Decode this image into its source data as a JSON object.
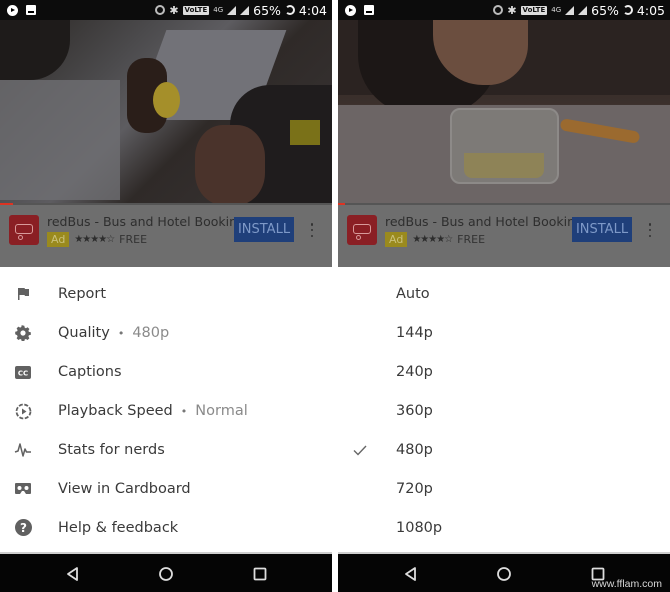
{
  "screens": [
    {
      "status_bar": {
        "battery": "65%",
        "time": "4:04",
        "volte": "VoLTE",
        "network": "4G"
      },
      "video": {
        "progress": 0.04
      },
      "ad": {
        "title": "redBus - Bus and Hotel Booking",
        "badge": "Ad",
        "stars": "★★★★☆",
        "price": "FREE",
        "install_label": "INSTALL"
      },
      "menu": {
        "items": [
          {
            "icon": "flag-icon",
            "label": "Report",
            "value": ""
          },
          {
            "icon": "gear-icon",
            "label": "Quality",
            "value": "480p"
          },
          {
            "icon": "closed-captions-icon",
            "label": "Captions",
            "value": ""
          },
          {
            "icon": "playback-speed-icon",
            "label": "Playback Speed",
            "value": "Normal"
          },
          {
            "icon": "stats-pulse-icon",
            "label": "Stats for nerds",
            "value": ""
          },
          {
            "icon": "cardboard-vr-icon",
            "label": "View in Cardboard",
            "value": ""
          },
          {
            "icon": "help-icon",
            "label": "Help & feedback",
            "value": ""
          }
        ],
        "separator": "•"
      }
    },
    {
      "status_bar": {
        "battery": "65%",
        "time": "4:05",
        "volte": "VoLTE",
        "network": "4G"
      },
      "video": {
        "progress": 0.02
      },
      "ad": {
        "title": "redBus - Bus and Hotel Booking",
        "badge": "Ad",
        "stars": "★★★★☆",
        "price": "FREE",
        "install_label": "INSTALL"
      },
      "quality_menu": {
        "selected": "480p",
        "options": [
          "Auto",
          "144p",
          "240p",
          "360p",
          "480p",
          "720p",
          "1080p"
        ]
      }
    }
  ],
  "watermark": "www.fflam.com"
}
